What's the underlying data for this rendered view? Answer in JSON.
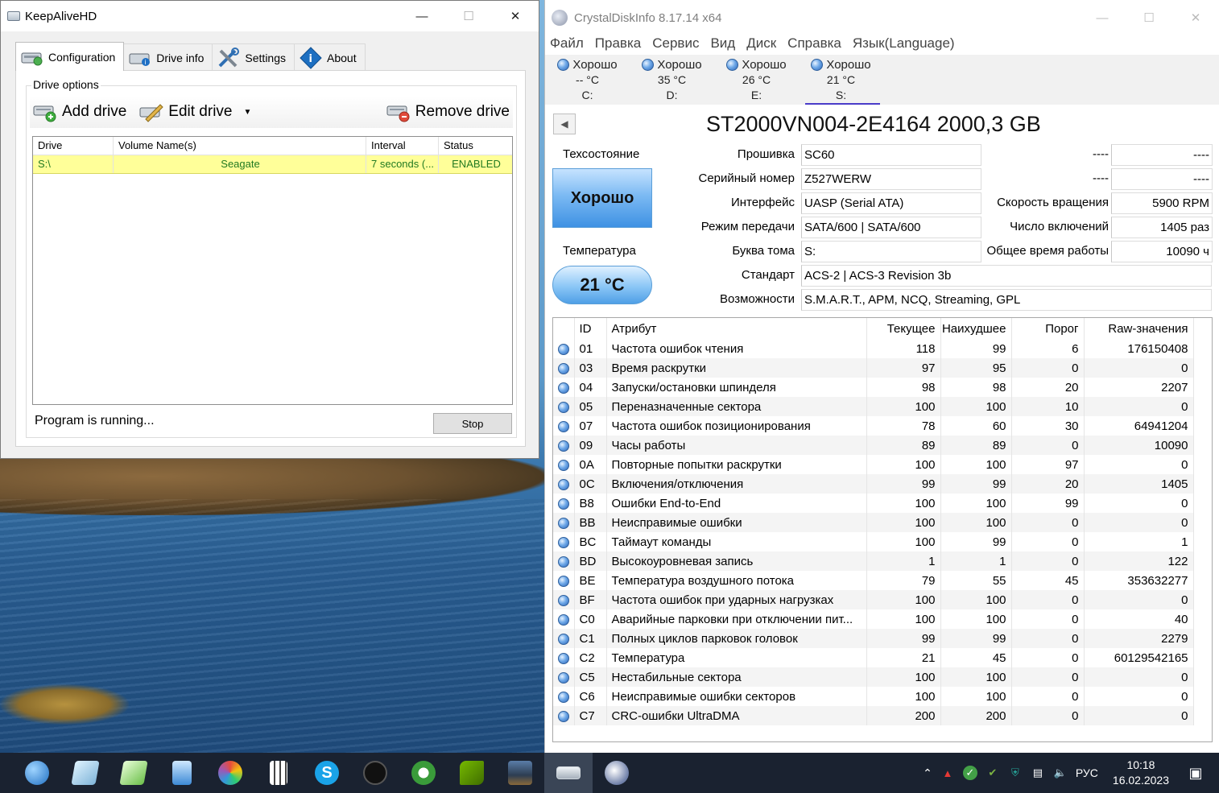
{
  "keepalive": {
    "title": "KeepAliveHD",
    "tabs": [
      "Configuration",
      "Drive info",
      "Settings",
      "About"
    ],
    "group_title": "Drive options",
    "add_drive": "Add drive",
    "edit_drive": "Edit drive",
    "remove_drive": "Remove drive",
    "columns": [
      "Drive",
      "Volume Name(s)",
      "Interval",
      "Status"
    ],
    "rows": [
      {
        "drive": "S:\\",
        "volume": "Seagate",
        "interval": "7 seconds (...",
        "status": "ENABLED"
      }
    ],
    "status_text": "Program is running...",
    "stop_label": "Stop"
  },
  "cdi": {
    "title": "CrystalDiskInfo 8.17.14 x64",
    "menu": [
      "Файл",
      "Правка",
      "Сервис",
      "Вид",
      "Диск",
      "Справка",
      "Язык(Language)"
    ],
    "drives": [
      {
        "status": "Хорошо",
        "temp": "-- °C",
        "letter": "C:"
      },
      {
        "status": "Хорошо",
        "temp": "35 °C",
        "letter": "D:"
      },
      {
        "status": "Хорошо",
        "temp": "26 °C",
        "letter": "E:"
      },
      {
        "status": "Хорошо",
        "temp": "21 °C",
        "letter": "S:"
      }
    ],
    "model": "ST2000VN004-2E4164 2000,3 GB",
    "health_label": "Техсостояние",
    "health_value": "Хорошо",
    "temp_label": "Температура",
    "temp_value": "21 °C",
    "labels": {
      "firmware": "Прошивка",
      "serial": "Серийный номер",
      "interface": "Интерфейс",
      "transfer": "Режим передачи",
      "volume": "Буква тома",
      "standard": "Стандарт",
      "features": "Возможности",
      "rotation": "Скорость вращения",
      "power_count": "Число включений",
      "power_hours": "Общее время работы",
      "blank1": "----",
      "blank2": "----"
    },
    "values": {
      "firmware": "SC60",
      "serial": "Z527WERW",
      "interface": "UASP (Serial ATA)",
      "transfer": "SATA/600 | SATA/600",
      "volume": "S:",
      "standard": "ACS-2 | ACS-3 Revision 3b",
      "features": "S.M.A.R.T., APM, NCQ, Streaming, GPL",
      "rotation": "5900 RPM",
      "power_count": "1405 раз",
      "power_hours": "10090 ч",
      "blank1": "----",
      "blank2": "----"
    },
    "smart_headers": [
      "ID",
      "Атрибут",
      "Текущее",
      "Наихудшее",
      "Порог",
      "Raw-значения"
    ],
    "smart_rows": [
      [
        "01",
        "Частота ошибок чтения",
        "118",
        "99",
        "6",
        "176150408"
      ],
      [
        "03",
        "Время раскрутки",
        "97",
        "95",
        "0",
        "0"
      ],
      [
        "04",
        "Запуски/остановки шпинделя",
        "98",
        "98",
        "20",
        "2207"
      ],
      [
        "05",
        "Переназначенные сектора",
        "100",
        "100",
        "10",
        "0"
      ],
      [
        "07",
        "Частота ошибок позиционирования",
        "78",
        "60",
        "30",
        "64941204"
      ],
      [
        "09",
        "Часы работы",
        "89",
        "89",
        "0",
        "10090"
      ],
      [
        "0A",
        "Повторные попытки раскрутки",
        "100",
        "100",
        "97",
        "0"
      ],
      [
        "0C",
        "Включения/отключения",
        "99",
        "99",
        "20",
        "1405"
      ],
      [
        "B8",
        "Ошибки End-to-End",
        "100",
        "100",
        "99",
        "0"
      ],
      [
        "BB",
        "Неисправимые ошибки",
        "100",
        "100",
        "0",
        "0"
      ],
      [
        "BC",
        "Таймаут команды",
        "100",
        "99",
        "0",
        "1"
      ],
      [
        "BD",
        "Высокоуровневая запись",
        "1",
        "1",
        "0",
        "122"
      ],
      [
        "BE",
        "Температура воздушного потока",
        "79",
        "55",
        "45",
        "353632277"
      ],
      [
        "BF",
        "Частота ошибок при ударных нагрузках",
        "100",
        "100",
        "0",
        "0"
      ],
      [
        "C0",
        "Аварийные парковки при отключении пит...",
        "100",
        "100",
        "0",
        "40"
      ],
      [
        "C1",
        "Полных циклов парковок головок",
        "99",
        "99",
        "0",
        "2279"
      ],
      [
        "C2",
        "Температура",
        "21",
        "45",
        "0",
        "60129542165"
      ],
      [
        "C5",
        "Нестабильные сектора",
        "100",
        "100",
        "0",
        "0"
      ],
      [
        "C6",
        "Неисправимые ошибки секторов",
        "100",
        "100",
        "0",
        "0"
      ],
      [
        "C7",
        "CRC-ошибки UltraDMA",
        "200",
        "200",
        "0",
        "0"
      ]
    ]
  },
  "taskbar": {
    "apps": [
      "globe-icon",
      "notepad-icon",
      "notes-icon",
      "notepad-blue-icon",
      "paint-icon",
      "calculator-icon",
      "skype-icon",
      "circle-app-icon",
      "xbox-icon",
      "nvidia-icon",
      "photo-icon",
      "drive-icon",
      "crystaldiskinfo-icon"
    ],
    "lang": "РУС",
    "time": "10:18",
    "date": "16.02.2023"
  },
  "colors": {
    "good_blue": "#3e91e3",
    "enabled_green": "#217a21",
    "row_highlight": "#ffff99",
    "taskbar": "#1a2230"
  }
}
